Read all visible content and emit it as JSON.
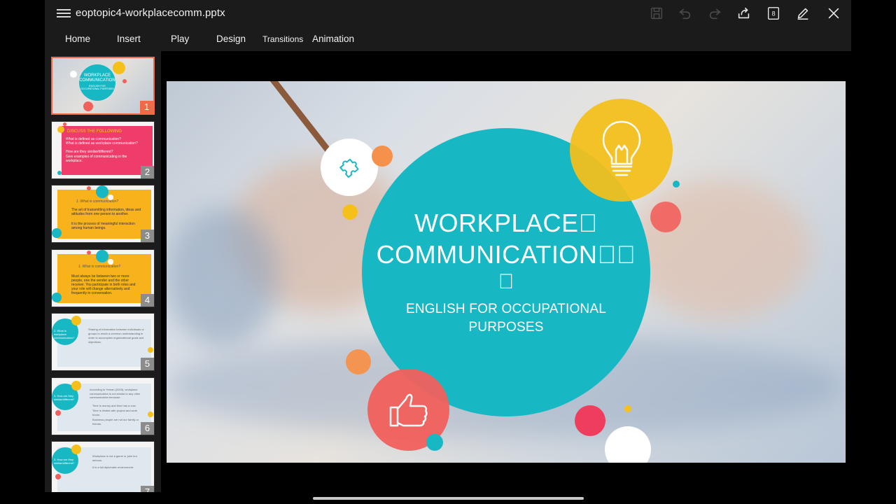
{
  "app": {
    "filename": "eoptopic4-workplacecomm.pptx",
    "slide_count_badge": "8"
  },
  "toolbar": {
    "icons": [
      "save-icon",
      "undo-icon",
      "redo-icon",
      "share-icon",
      "slide-count-icon",
      "edit-pen-icon",
      "close-icon"
    ]
  },
  "tabs": [
    "Home",
    "Insert",
    "Play",
    "Design",
    "Transitions",
    "Animation"
  ],
  "thumbnails": [
    {
      "number": "1",
      "title": "WORKPLACE COMMUNICATION",
      "subtitle": "ENGLISH FOR OCCUPATIONAL PURPOSES"
    },
    {
      "number": "2",
      "title": "DISCUSS THE FOLLOWING",
      "lines": [
        "What is defined as communication?",
        "What is defined as workplace communication?",
        "How are they similar/different?",
        "Give examples of communicating in the workplace."
      ]
    },
    {
      "number": "3",
      "title": "1. What is communication?",
      "lines": [
        "The art of transmitting information, ideas and attitudes from one person to another.",
        "It is the process of meaningful interaction among human beings."
      ]
    },
    {
      "number": "4",
      "title": "1. What is communication?",
      "lines": [
        "Must always be between two or more people, one the sender and the other receiver. You participate in both roles and your role will change alternatively and frequently in conversation."
      ]
    },
    {
      "number": "5",
      "title": "2. What is workplace communication?",
      "lines": [
        "Sharing of information between individuals or groups to reach a common understanding in order to accomplish organizational goals and objectives."
      ]
    },
    {
      "number": "6",
      "title": "3. How are they similar/different?",
      "lines": [
        "According to Yeman (2005), workplace communication is not similar to any other communication because:",
        "Time is money and time has a cost.",
        "Time is limited with project and work hours.",
        "Business people are not our family or friends."
      ]
    },
    {
      "number": "7",
      "title": "3. How are they similar/different?",
      "lines": [
        "Workplace is not a game or joke but serious.",
        "It is a full diplomatic environment."
      ]
    }
  ],
  "slide": {
    "title_line1": "WORKPLACE\u0000",
    "title_line2": "COMMUNICATION\u0000\u0000",
    "title_line3": "\u0000",
    "subtitle_line1": "ENGLISH FOR OCCUPATIONAL",
    "subtitle_line2": "PURPOSES",
    "colors": {
      "teal": "#17b8c4",
      "yellow": "#f5c01a",
      "coral": "#f2605c",
      "orange": "#f5914a",
      "pink": "#ef3d5e",
      "white": "#ffffff"
    },
    "icons": [
      "puzzle-icon",
      "lightbulb-icon",
      "thumbs-up-icon"
    ]
  }
}
